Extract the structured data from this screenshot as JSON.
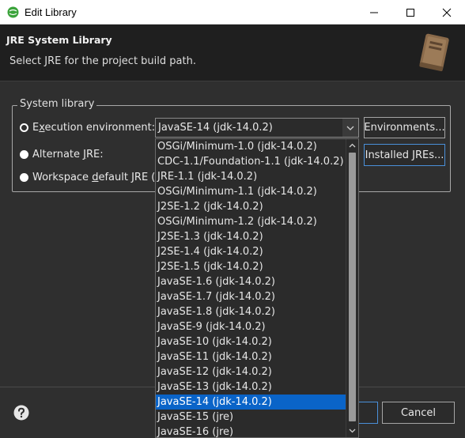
{
  "window": {
    "title": "Edit Library",
    "controls": [
      "minimize-icon",
      "maximize-icon",
      "close-icon"
    ]
  },
  "header": {
    "title": "JRE System Library",
    "subtitle": "Select JRE for the project build path.",
    "icon": "library-book-icon"
  },
  "system_library": {
    "group_label": "System library",
    "execution_environment": {
      "label_prefix": "E",
      "label_mnemonic": "x",
      "label_rest": "ecution environment:",
      "selected": true,
      "value": "JavaSE-14 (jdk-14.0.2)"
    },
    "alternate_jre": {
      "label_prefix": "Alternate ",
      "label_mnemonic": "J",
      "label_rest": "RE:",
      "selected": false
    },
    "workspace_default": {
      "label_prefix": "Workspace ",
      "label_mnemonic": "d",
      "label_rest": "efault JRE (jd",
      "selected": false
    },
    "environments_button": "Environments...",
    "installed_jres_button": "Installed JREs..."
  },
  "dropdown": {
    "items": [
      "OSGi/Minimum-1.0 (jdk-14.0.2)",
      "CDC-1.1/Foundation-1.1 (jdk-14.0.2)",
      "JRE-1.1 (jdk-14.0.2)",
      "OSGi/Minimum-1.1 (jdk-14.0.2)",
      "J2SE-1.2 (jdk-14.0.2)",
      "OSGi/Minimum-1.2 (jdk-14.0.2)",
      "J2SE-1.3 (jdk-14.0.2)",
      "J2SE-1.4 (jdk-14.0.2)",
      "J2SE-1.5 (jdk-14.0.2)",
      "JavaSE-1.6 (jdk-14.0.2)",
      "JavaSE-1.7 (jdk-14.0.2)",
      "JavaSE-1.8 (jdk-14.0.2)",
      "JavaSE-9 (jdk-14.0.2)",
      "JavaSE-10 (jdk-14.0.2)",
      "JavaSE-11 (jdk-14.0.2)",
      "JavaSE-12 (jdk-14.0.2)",
      "JavaSE-13 (jdk-14.0.2)",
      "JavaSE-14 (jdk-14.0.2)",
      "JavaSE-15 (jre)",
      "JavaSE-16 (jre)"
    ],
    "selected_index": 17
  },
  "footer": {
    "cancel_button": "Cancel",
    "help_icon": "help-icon"
  },
  "colors": {
    "background": "#2f2f2f",
    "header_background": "#1f1f1f",
    "selection": "#0a64c8",
    "accent_border": "#4a90d9"
  }
}
